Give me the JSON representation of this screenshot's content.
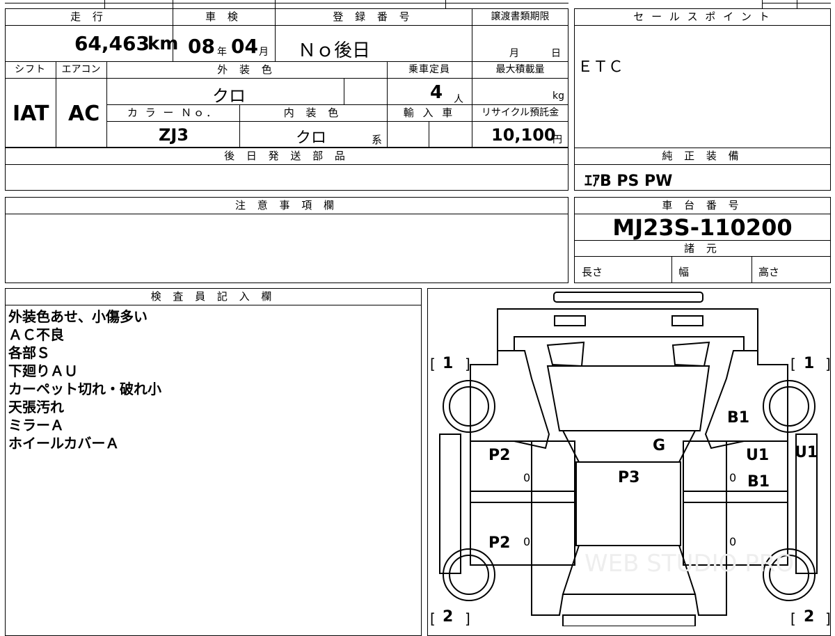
{
  "header_row": {
    "mileage_label": "走 行",
    "inspection_label": "車 検",
    "registration_label": "登 録 番 号",
    "transfer_deadline_label": "譲渡書類期限",
    "sale_points_label": "セ ー ル ス ポ イ ン ト"
  },
  "vehicle": {
    "mileage_value": "64,463",
    "mileage_unit": "km",
    "inspection_year": "08",
    "inspection_year_unit": "年",
    "inspection_month": "04",
    "inspection_month_unit": "月",
    "registration_value": "Ｎｏ後日",
    "deadline_month_unit": "月",
    "deadline_day_unit": "日",
    "sale_points_value": "ＥＴＣ"
  },
  "row2": {
    "shift_label": "シフト",
    "aircon_label": "エアコン",
    "exterior_color_label": "外 装 色",
    "capacity_label": "乗車定員",
    "max_load_label": "最大積載量",
    "shift_value": "IAT",
    "aircon_value": "AC",
    "exterior_color_value": "クロ",
    "capacity_value": "4",
    "capacity_unit": "人",
    "max_load_unit": "kg",
    "color_no_label": "カ ラ ー Ｎｏ．",
    "interior_color_label": "内 装 色",
    "import_label": "輸 入 車",
    "recycle_label": "リサイクル預託金",
    "color_no_value": "ZJ3",
    "interior_color_value": "クロ",
    "interior_color_suffix": "系",
    "recycle_value": "10,100",
    "recycle_unit": "円"
  },
  "later_parts": {
    "label": "後 日 発 送 部 品"
  },
  "genuine_equipment": {
    "label": "純 正 装 備",
    "value": "ｴｱB PS PW"
  },
  "notes": {
    "label": "注 意 事 項 欄"
  },
  "chassis": {
    "label": "車 台 番 号",
    "value": "MJ23S-110200",
    "specs_label": "諸 元",
    "length_label": "長さ",
    "width_label": "幅",
    "height_label": "高さ"
  },
  "inspector": {
    "label": "検 査 員 記 入 欄",
    "lines": [
      "外装色あせ、小傷多い",
      "ＡＣ不良",
      "各部Ｓ",
      "下廻りＡＵ",
      "カーペット切れ・破れ小",
      "天張汚れ",
      "ミラーＡ",
      "ホイールカバーＡ"
    ]
  },
  "diagram": {
    "corner_tl": "1",
    "corner_tr": "1",
    "corner_bl": "2",
    "corner_br": "2",
    "mark_b1_top": "B1",
    "mark_g": "G",
    "mark_p2_left_front": "P2",
    "mark_p3": "P3",
    "mark_u1_right_door": "U1",
    "mark_u1_right_side": "U1",
    "mark_b1_right_door": "B1",
    "mark_p2_left_rear": "P2",
    "watermark": "WEB STUDIO PRO"
  }
}
